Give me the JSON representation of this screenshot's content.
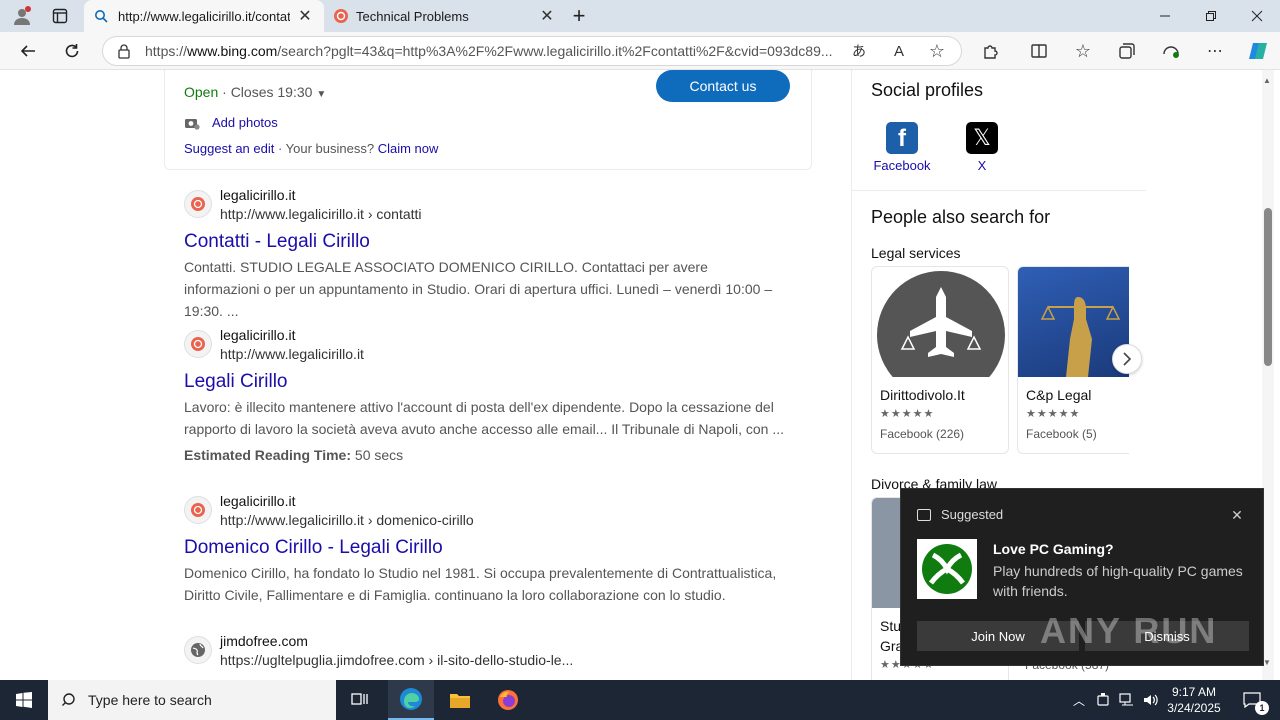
{
  "browser": {
    "tabs": [
      {
        "title": "http://www.legalicirillo.it/contatti",
        "active": true
      },
      {
        "title": "Technical Problems",
        "active": false
      }
    ],
    "address": {
      "prefix": "https://",
      "host": "www.bing.com",
      "path": "/search?pglt=43&q=http%3A%2F%2Fwww.legalicirillo.it%2Fcontatti%2F&cvid=093dc89..."
    }
  },
  "business": {
    "open": "Open",
    "closes": " · Closes 19:30",
    "contact_button": "Contact us",
    "add_photos": "Add photos",
    "suggest_edit": "Suggest an edit",
    "your_business": " · Your business? ",
    "claim_now": "Claim now"
  },
  "results": [
    {
      "site": "legalicirillo.it",
      "url": "http://www.legalicirillo.it › contatti",
      "title": "Contatti - Legali Cirillo",
      "snippet": "Contatti. STUDIO LEGALE ASSOCIATO DOMENICO CIRILLO. Contattaci per avere informazioni o per un appuntamento in Studio. Orari di apertura uffici. Lunedì – venerdì 10:00 – 19:30. ..."
    },
    {
      "site": "legalicirillo.it",
      "url": "http://www.legalicirillo.it",
      "title": "Legali Cirillo",
      "snippet": "Lavoro: è illecito mantenere attivo l'account di posta dell'ex dipendente. Dopo la cessazione del rapporto di lavoro la società aveva avuto anche accesso alle email... Il Tribunale di Napoli, con ...",
      "reading_label": "Estimated Reading Time:",
      "reading_value": " 50 secs"
    },
    {
      "site": "legalicirillo.it",
      "url": "http://www.legalicirillo.it › domenico-cirillo",
      "title": "Domenico Cirillo - Legali Cirillo",
      "snippet": "Domenico Cirillo, ha fondato lo Studio nel 1981. Si occupa prevalentemente di Contrattualistica, Diritto Civile, Fallimentare e di Famiglia. continuano la loro collaborazione con lo studio."
    },
    {
      "site": "jimdofree.com",
      "url": "https://ugltelpuglia.jimdofree.com › il-sito-dello-studio-le..."
    }
  ],
  "sidebar": {
    "social_title": "Social profiles",
    "social": [
      {
        "label": "Facebook"
      },
      {
        "label": "X"
      }
    ],
    "people_title": "People also search for",
    "legal_services": "Legal services",
    "cards": [
      {
        "name": "Dirittodivolo.It",
        "rating": "Facebook (226)"
      },
      {
        "name": "C&p Legal",
        "rating": "Facebook (5)"
      }
    ],
    "divorce": "Divorce & family law",
    "partial_1": "Stu",
    "partial_2": "Gra",
    "partial_3": "Facebook (587)"
  },
  "notification": {
    "header": "Suggested",
    "title": "Love PC Gaming?",
    "body": "Play hundreds of high-quality PC games with friends.",
    "join": "Join Now",
    "dismiss": "Dismiss"
  },
  "watermark": "ANY RUN",
  "taskbar": {
    "search_placeholder": "Type here to search",
    "time": "9:17 AM",
    "date": "3/24/2025",
    "notif_count": "1"
  },
  "colors": {
    "accent": "#0f6cbd",
    "link": "#1a0dab",
    "xbox": "#107c10",
    "taskbar": "#1c2634"
  }
}
